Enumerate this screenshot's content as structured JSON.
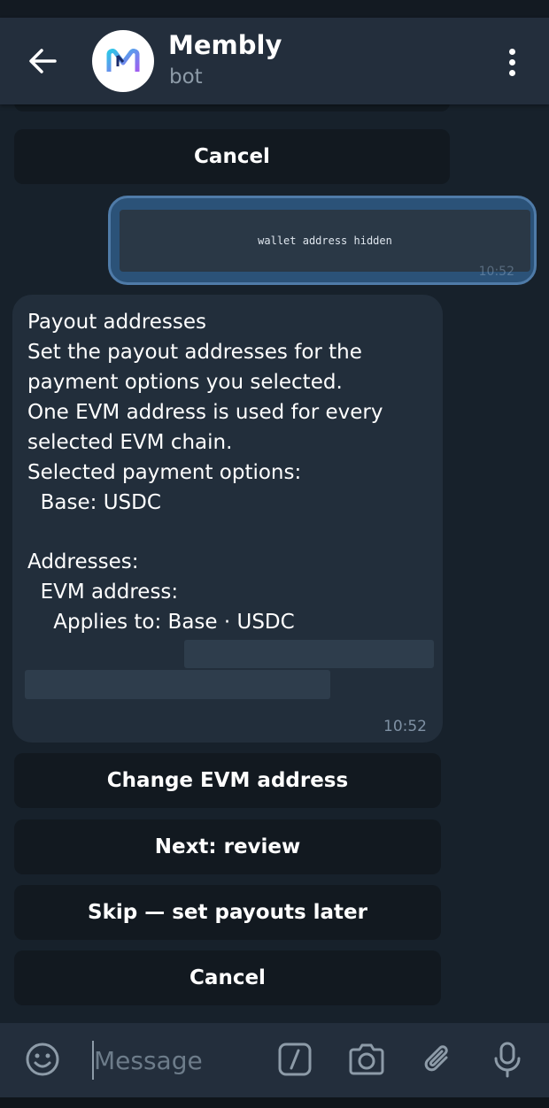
{
  "header": {
    "title": "Membly",
    "subtitle": "bot"
  },
  "chat": {
    "top_cancel_label": "Cancel",
    "outgoing": {
      "placeholder_text": "wallet address hidden",
      "time": "10:52"
    },
    "incoming": {
      "lines": [
        "Payout addresses",
        "",
        "Set the payout addresses for the",
        "payment options you selected.",
        "One EVM address is used for every",
        "selected EVM chain.",
        "",
        "Selected payment options:",
        "  Base: USDC",
        "",
        "Addresses:",
        "  EVM address:",
        "",
        "    Applies to: Base · USDC"
      ],
      "time": "10:52"
    },
    "buttons": [
      "Change EVM address",
      "Next: review",
      "Skip — set payouts later",
      "Cancel"
    ]
  },
  "composer": {
    "placeholder": "Message"
  },
  "colors": {
    "background": "#17212b",
    "header": "#232e3c",
    "outgoing_bubble": "#2b5278",
    "incoming_bubble": "#222e3b",
    "keyboard_button": "#121920"
  }
}
